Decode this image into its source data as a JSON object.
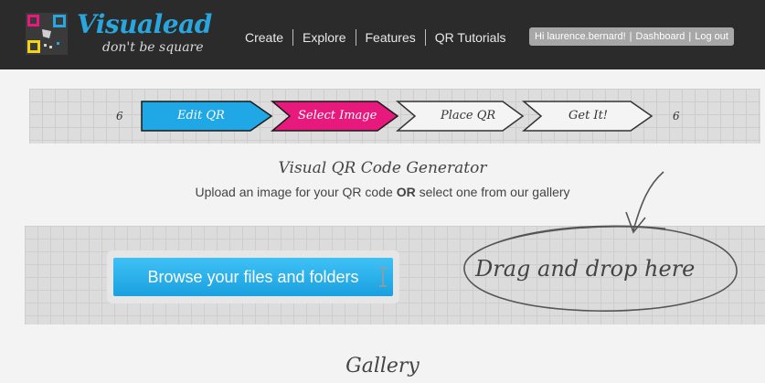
{
  "header": {
    "brand": "Visualead",
    "tagline": "don't be square",
    "nav": [
      "Create",
      "Explore",
      "Features",
      "QR Tutorials"
    ],
    "user": {
      "greeting": "Hi laurence.bernard!",
      "dashboard": "Dashboard",
      "logout": "Log out"
    }
  },
  "steps": {
    "left_marker": "6",
    "right_marker": "6",
    "items": [
      {
        "label": "Edit QR",
        "color": "#1fa8e5"
      },
      {
        "label": "Select Image",
        "color": "#e8197d"
      },
      {
        "label": "Place QR",
        "color": "#f4f4f4"
      },
      {
        "label": "Get It!",
        "color": "#f4f4f4"
      }
    ]
  },
  "main": {
    "title": "Visual QR Code Generator",
    "subtitle_pre": "Upload an image for your QR code",
    "subtitle_or": "OR",
    "subtitle_post": "select one from our gallery",
    "browse_button": "Browse your files and folders",
    "drag_drop": "Drag and drop here",
    "gallery_title": "Gallery"
  },
  "colors": {
    "accent_blue": "#1fa8e5",
    "accent_pink": "#e8197d",
    "header_bg": "#2b2b2b"
  }
}
